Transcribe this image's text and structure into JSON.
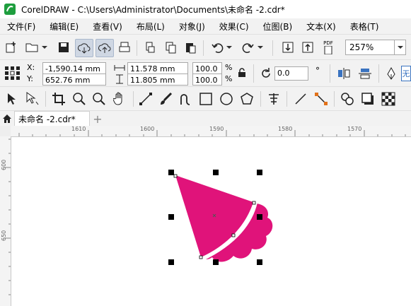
{
  "window": {
    "title": "CorelDRAW - C:\\Users\\Administrator\\Documents\\未命名 -2.cdr*"
  },
  "menu": [
    "文件(F)",
    "编辑(E)",
    "查看(V)",
    "布局(L)",
    "对象(J)",
    "效果(C)",
    "位图(B)",
    "文本(X)",
    "表格(T)"
  ],
  "toolbar": {
    "zoom_value": "257%",
    "pdf_label": "PDF"
  },
  "properties": {
    "x_label": "X:",
    "y_label": "Y:",
    "x_value": "-1,590.14 mm",
    "y_value": "652.76 mm",
    "width_value": "11.578 mm",
    "height_value": "11.805 mm",
    "scale_x": "100.0",
    "scale_y": "100.0",
    "pct1": "%",
    "pct2": "%",
    "rotation": "0.0",
    "degree": "°",
    "overflow_text": "无"
  },
  "document_tab": {
    "label": "未命名 -2.cdr*",
    "add_label": "+"
  },
  "ruler": {
    "h_ticks": [
      "1610",
      "1600",
      "1590",
      "1580",
      "1570"
    ],
    "v_ticks": [
      "600",
      "650"
    ]
  },
  "shape": {
    "fill_color": "#e0137a"
  },
  "colors": {
    "accent": "#1e9e3e",
    "tab_bg": "#ffffff"
  }
}
